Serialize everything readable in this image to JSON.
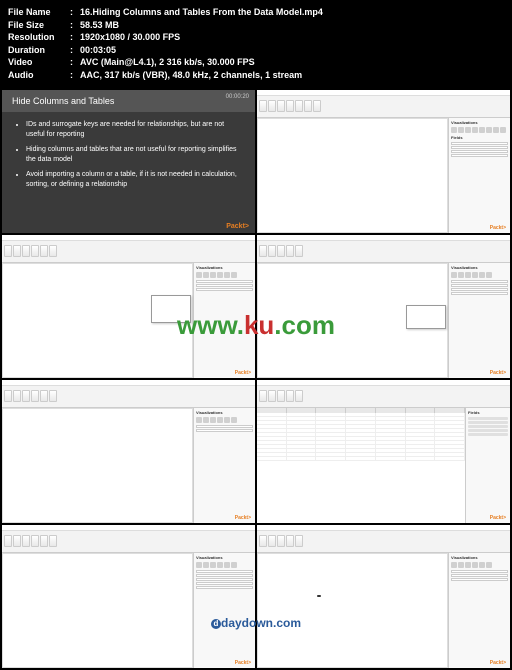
{
  "meta": {
    "filename_label": "File Name",
    "filename_value": "16.Hiding Columns and Tables From the Data Model.mp4",
    "filesize_label": "File Size",
    "filesize_value": "58.53 MB",
    "resolution_label": "Resolution",
    "resolution_value": "1920x1080 / 30.000 FPS",
    "duration_label": "Duration",
    "duration_value": "00:03:05",
    "video_label": "Video",
    "video_value": "AVC (Main@L4.1), 2 316 kb/s, 30.000 FPS",
    "audio_label": "Audio",
    "audio_value": "AAC, 317 kb/s (VBR), 48.0 kHz, 2 channels, 1 stream"
  },
  "slide": {
    "title": "Hide Columns and Tables",
    "timestamp": "00:00:20",
    "bullets": [
      "IDs and surrogate keys are needed for relationships, but are not useful for reporting",
      "Hiding columns and tables that are not useful for reporting simplifies the data model",
      "Avoid importing a column or a table, if it is not needed in calculation, sorting, or defining a relationship"
    ],
    "brand": "Packt>"
  },
  "sidepanel": {
    "viz_title": "Visualizations",
    "fields_title": "Fields"
  },
  "watermark": {
    "prefix": "www.",
    "mid": "ku",
    "suffix": ".com"
  },
  "watermark2": {
    "circle": "d",
    "text": "daydown.com"
  }
}
